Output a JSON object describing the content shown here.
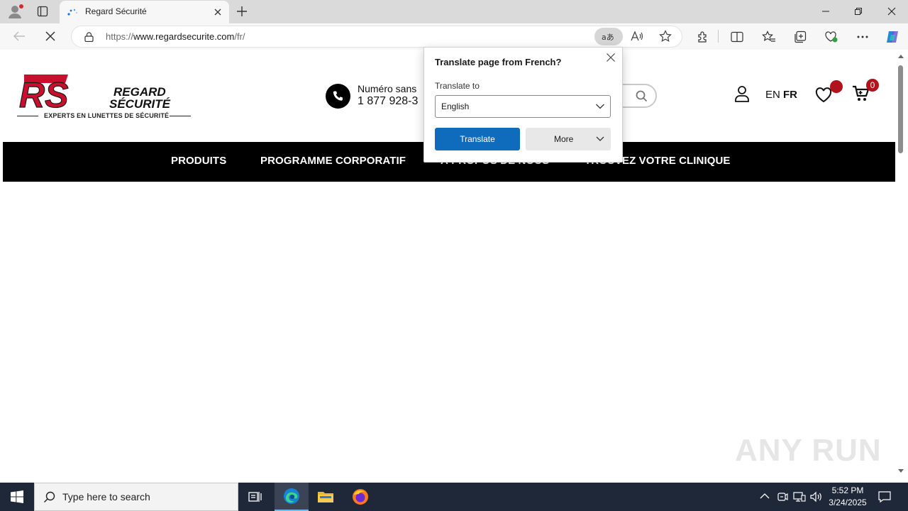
{
  "browser": {
    "tab": {
      "title": "Regard Sécurité"
    },
    "url": {
      "prefix": "https://",
      "host": "www.regardsecurite.com",
      "path": "/fr/"
    }
  },
  "site": {
    "logo": {
      "initials": "RS",
      "line1": "REGARD",
      "line2": "SÉCURITÉ",
      "tagline": "EXPERTS EN LUNETTES DE SÉCURITÉ",
      "brand_color": "#c8102e"
    },
    "phone": {
      "label": "Numéro sans",
      "number": "1 877 928-3"
    },
    "lang": {
      "en": "EN",
      "fr": "FR"
    },
    "wishlist_badge": "",
    "cart_count": "0",
    "nav": [
      {
        "label": "PRODUITS"
      },
      {
        "label": "PROGRAMME CORPORATIF"
      },
      {
        "label": "À PROPOS DE NOUS"
      },
      {
        "label": "TROUVEZ VOTRE CLINIQUE"
      }
    ]
  },
  "translate_popup": {
    "title": "Translate page from French?",
    "translate_to_label": "Translate to",
    "selected_language": "English",
    "translate_button": "Translate",
    "more_button": "More"
  },
  "watermark": "ANY RUN",
  "taskbar": {
    "search_placeholder": "Type here to search",
    "time": "5:52 PM",
    "date": "3/24/2025"
  },
  "colors": {
    "accent_blue": "#0f6cbd",
    "taskbar": "#1f2838",
    "nav_bg": "#000000",
    "badge_red": "#b3121c"
  }
}
